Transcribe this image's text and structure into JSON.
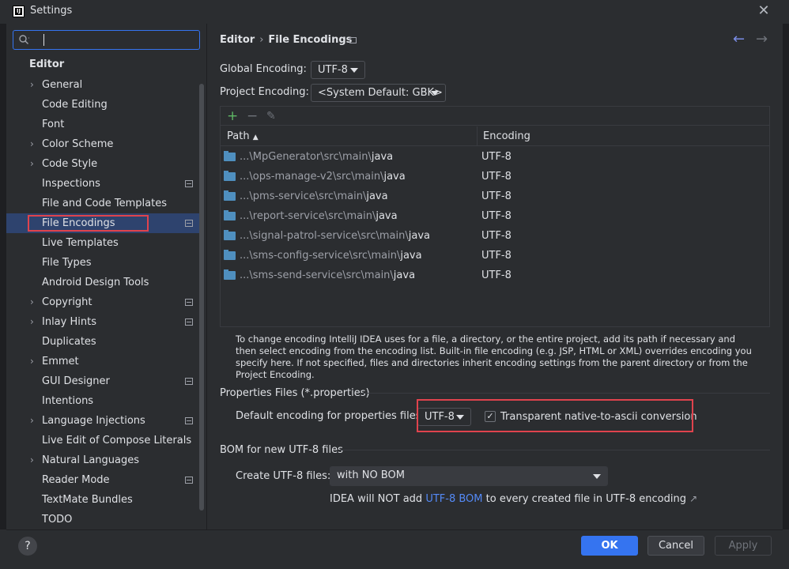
{
  "window": {
    "title": "Settings",
    "logo_text": "IJ"
  },
  "search": {
    "value": ""
  },
  "sidebar": {
    "section_title": "Editor",
    "items": [
      {
        "label": "General",
        "arrow": true,
        "mark": false
      },
      {
        "label": "Code Editing",
        "arrow": false,
        "mark": false
      },
      {
        "label": "Font",
        "arrow": false,
        "mark": false
      },
      {
        "label": "Color Scheme",
        "arrow": true,
        "mark": false
      },
      {
        "label": "Code Style",
        "arrow": true,
        "mark": false
      },
      {
        "label": "Inspections",
        "arrow": false,
        "mark": true
      },
      {
        "label": "File and Code Templates",
        "arrow": false,
        "mark": false
      },
      {
        "label": "File Encodings",
        "arrow": false,
        "mark": true,
        "selected": true
      },
      {
        "label": "Live Templates",
        "arrow": false,
        "mark": false
      },
      {
        "label": "File Types",
        "arrow": false,
        "mark": false
      },
      {
        "label": "Android Design Tools",
        "arrow": false,
        "mark": false
      },
      {
        "label": "Copyright",
        "arrow": true,
        "mark": true
      },
      {
        "label": "Inlay Hints",
        "arrow": true,
        "mark": true
      },
      {
        "label": "Duplicates",
        "arrow": false,
        "mark": false
      },
      {
        "label": "Emmet",
        "arrow": true,
        "mark": false
      },
      {
        "label": "GUI Designer",
        "arrow": false,
        "mark": true
      },
      {
        "label": "Intentions",
        "arrow": false,
        "mark": false
      },
      {
        "label": "Language Injections",
        "arrow": true,
        "mark": true
      },
      {
        "label": "Live Edit of Compose Literals",
        "arrow": false,
        "mark": false
      },
      {
        "label": "Natural Languages",
        "arrow": true,
        "mark": false
      },
      {
        "label": "Reader Mode",
        "arrow": false,
        "mark": true
      },
      {
        "label": "TextMate Bundles",
        "arrow": false,
        "mark": false
      },
      {
        "label": "TODO",
        "arrow": false,
        "mark": false
      }
    ]
  },
  "breadcrumb": {
    "parent": "Editor",
    "separator": "›",
    "current": "File Encodings"
  },
  "global_encoding": {
    "label": "Global Encoding:",
    "value": "UTF-8"
  },
  "project_encoding": {
    "label": "Project Encoding:",
    "value": "<System Default: GBK>"
  },
  "table": {
    "headers": {
      "path": "Path",
      "sort_indicator": "▲",
      "encoding": "Encoding"
    },
    "rows": [
      {
        "prefix": "...\\MpGenerator\\src\\main\\",
        "last": "java",
        "encoding": "UTF-8"
      },
      {
        "prefix": "...\\ops-manage-v2\\src\\main\\",
        "last": "java",
        "encoding": "UTF-8"
      },
      {
        "prefix": "...\\pms-service\\src\\main\\",
        "last": "java",
        "encoding": "UTF-8"
      },
      {
        "prefix": "...\\report-service\\src\\main\\",
        "last": "java",
        "encoding": "UTF-8"
      },
      {
        "prefix": "...\\signal-patrol-service\\src\\main\\",
        "last": "java",
        "encoding": "UTF-8"
      },
      {
        "prefix": "...\\sms-config-service\\src\\main\\",
        "last": "java",
        "encoding": "UTF-8"
      },
      {
        "prefix": "...\\sms-send-service\\src\\main\\",
        "last": "java",
        "encoding": "UTF-8"
      }
    ]
  },
  "hint_text": "To change encoding IntelliJ IDEA uses for a file, a directory, or the entire project, add its path if necessary and then select encoding from the encoding list. Built-in file encoding (e.g. JSP, HTML or XML) overrides encoding you specify here. If not specified, files and directories inherit encoding settings from the parent directory or from the Project Encoding.",
  "properties": {
    "group_title": "Properties Files (*.properties)",
    "default_label": "Default encoding for properties files:",
    "default_value": "UTF-8",
    "transparent_label": "Transparent native-to-ascii conversion",
    "transparent_checked": true,
    "check_glyph": "✓"
  },
  "bom": {
    "group_title": "BOM for new UTF-8 files",
    "create_label": "Create UTF-8 files:",
    "create_value": "with NO BOM",
    "note_before": "IDEA will NOT add ",
    "note_link": "UTF-8 BOM",
    "note_after": " to every created file in UTF-8 encoding",
    "ext_arrow": "↗"
  },
  "footer": {
    "help": "?",
    "ok": "OK",
    "cancel": "Cancel",
    "apply": "Apply"
  },
  "icons": {
    "close": "✕",
    "back": "←",
    "forward": "→",
    "add": "+",
    "remove": "−",
    "edit": "✎",
    "expand": "›"
  }
}
